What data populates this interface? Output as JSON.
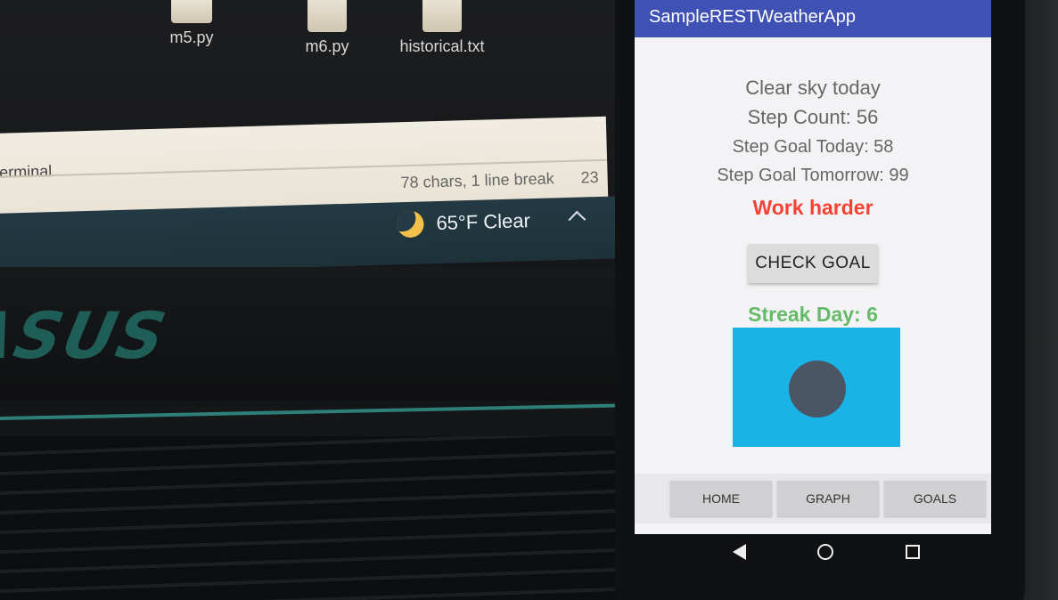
{
  "desktop": {
    "files": [
      {
        "name": "m5.py",
        "icon": "python-file-icon"
      },
      {
        "name": "m6.py",
        "icon": "python-file-icon"
      },
      {
        "name": "historical.txt",
        "icon": "text-file-icon"
      }
    ],
    "notepad": {
      "title": "erminal",
      "status": "78 chars, 1 line break",
      "column": "23"
    },
    "taskbar": {
      "weather": "65°F  Clear",
      "weather_icon": "moon-icon"
    },
    "laptop_brand": "ASUS"
  },
  "app": {
    "title": "SampleRESTWeatherApp",
    "bar_color": "#3f51b5",
    "weather": "Clear sky today",
    "step_count": "Step Count: 56",
    "goal_today": "Step Goal Today: 58",
    "goal_tomorrow": "Step Goal Tomorrow: 99",
    "feedback": "Work harder",
    "feedback_color": "#f44336",
    "check_goal_label": "CHECK GOAL",
    "streak": "Streak Day: 6",
    "streak_color": "#66bb6a",
    "tabs": [
      {
        "label": "HOME"
      },
      {
        "label": "GRAPH"
      },
      {
        "label": "GOALS"
      }
    ]
  },
  "system_nav": {
    "back": "back-icon",
    "home": "home-icon",
    "recents": "recents-icon"
  }
}
